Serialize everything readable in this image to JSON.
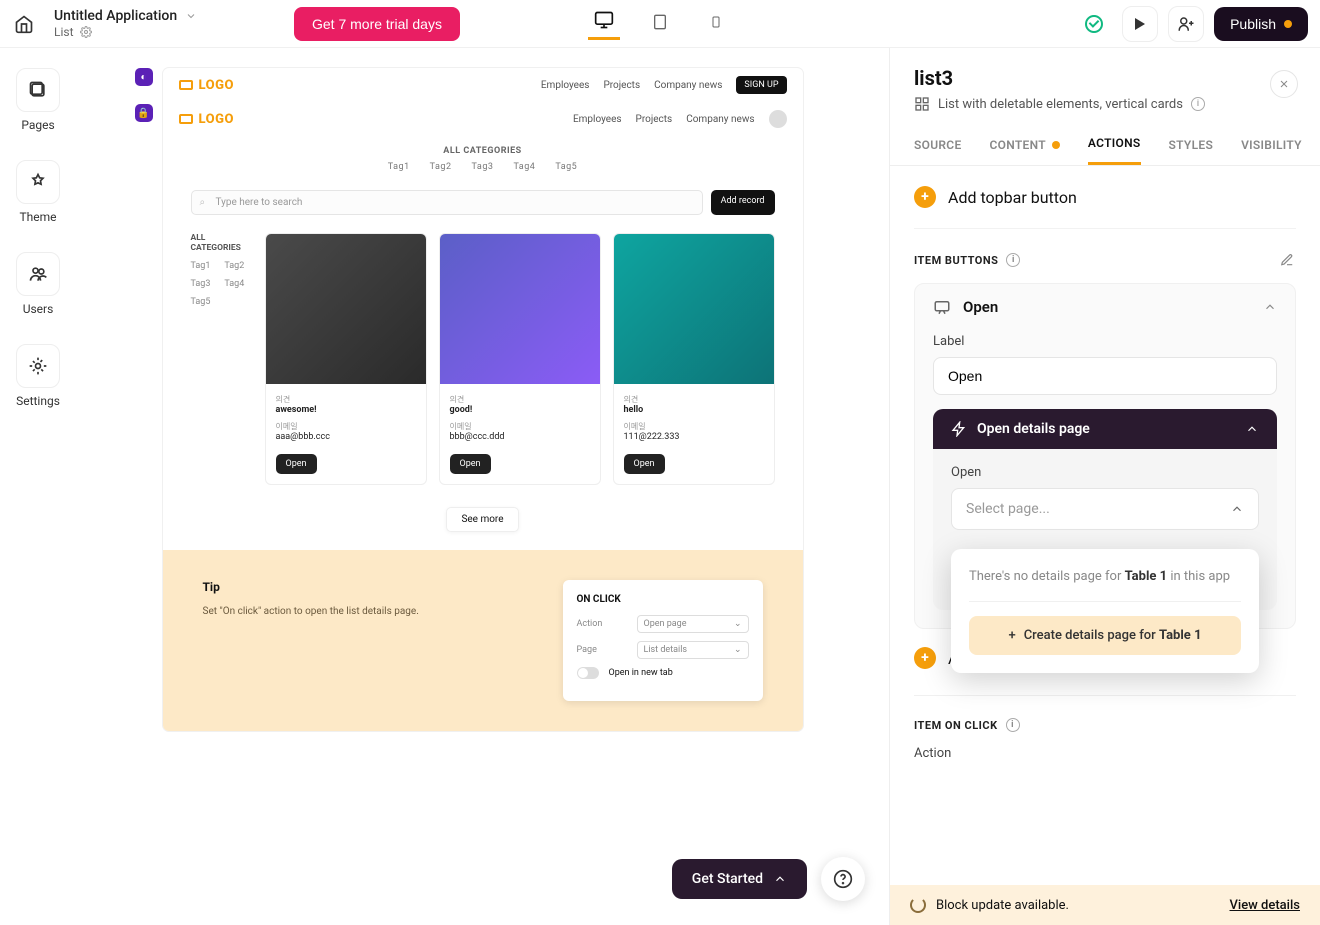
{
  "topbar": {
    "app_title": "Untitled Application",
    "breadcrumb": "List",
    "trial_label": "Get 7 more trial days",
    "publish_label": "Publish"
  },
  "leftnav": {
    "pages": "Pages",
    "theme": "Theme",
    "users": "Users",
    "settings": "Settings"
  },
  "preview": {
    "logo_text": "LOGO",
    "nav1": [
      "Employees",
      "Projects",
      "Company news"
    ],
    "signup": "SIGN UP",
    "nav2": [
      "Employees",
      "Projects",
      "Company news"
    ],
    "all_categories": "ALL CATEGORIES",
    "tags": [
      "Tag1",
      "Tag2",
      "Tag3",
      "Tag4",
      "Tag5"
    ],
    "search_placeholder": "Type here to search",
    "add_record": "Add record",
    "side_all": "ALL CATEGORIES",
    "cards": [
      {
        "opinion_label": "의견",
        "opinion_value": "awesome!",
        "email_label": "이메일",
        "email_value": "aaa@bbb.ccc",
        "open": "Open"
      },
      {
        "opinion_label": "의견",
        "opinion_value": "good!",
        "email_label": "이메일",
        "email_value": "bbb@ccc.ddd",
        "open": "Open"
      },
      {
        "opinion_label": "의견",
        "opinion_value": "hello",
        "email_label": "이메일",
        "email_value": "111@222.333",
        "open": "Open"
      }
    ],
    "see_more": "See more",
    "tip_title": "Tip",
    "tip_desc": "Set \"On click\" action to open the list details page.",
    "onclick_title": "ON CLICK",
    "action_label": "Action",
    "action_value": "Open page",
    "page_label": "Page",
    "page_value": "List details",
    "newtab_label": "Open in new tab"
  },
  "fab": {
    "get_started": "Get Started"
  },
  "panel": {
    "name": "list3",
    "desc": "List with deletable elements, vertical cards",
    "tabs": {
      "source": "SOURCE",
      "content": "CONTENT",
      "actions": "ACTIONS",
      "styles": "STYLES",
      "visibility": "VISIBILITY"
    },
    "add_topbar": "Add topbar button",
    "item_buttons": "ITEM BUTTONS",
    "open_block_title": "Open",
    "label_field": "Label",
    "label_value": "Open",
    "sub_title": "Open details page",
    "open_sub_label": "Open",
    "select_placeholder": "Select page...",
    "dd_text_prefix": "There's no details page for ",
    "dd_text_table": "Table 1",
    "dd_text_suffix": " in this app",
    "dd_create_prefix": "Create details page for ",
    "dd_create_table": "Table 1",
    "add_item": "Add item button",
    "item_on_click": "ITEM ON CLICK",
    "action_label": "Action",
    "update_text": "Block update available.",
    "view_details": "View details"
  }
}
